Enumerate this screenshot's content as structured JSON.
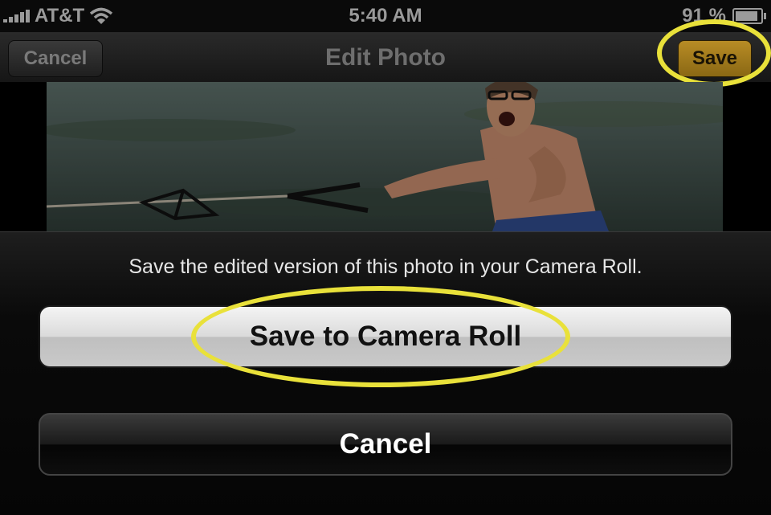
{
  "status_bar": {
    "carrier": "AT&T",
    "time": "5:40 AM",
    "battery_percent": "91 %",
    "battery_level": 0.91
  },
  "nav_bar": {
    "title": "Edit Photo",
    "cancel_label": "Cancel",
    "save_label": "Save"
  },
  "action_sheet": {
    "message": "Save the edited version of this photo in your Camera Roll.",
    "save_to_camera_roll_label": "Save to Camera Roll",
    "cancel_label": "Cancel"
  },
  "colors": {
    "highlight": "#e9e13a",
    "save_button": "#b88c25"
  },
  "icons": [
    "signal-bars-icon",
    "wifi-icon",
    "battery-icon"
  ]
}
